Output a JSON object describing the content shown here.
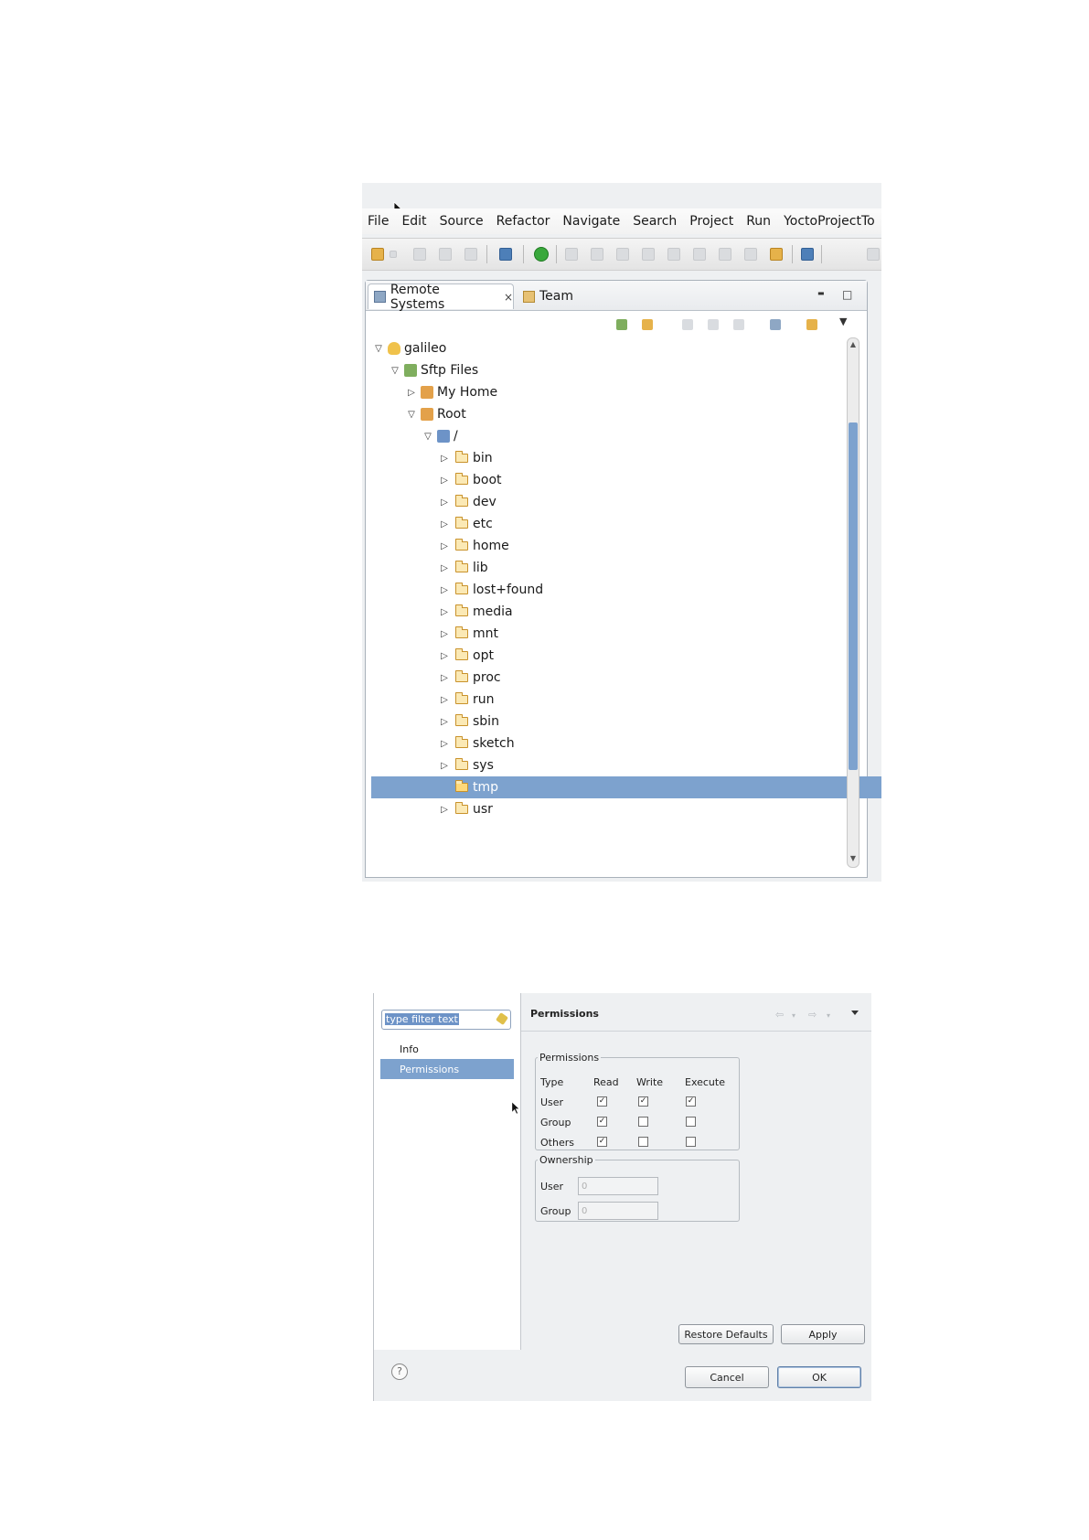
{
  "eclipse": {
    "menu": [
      "File",
      "Edit",
      "Source",
      "Refactor",
      "Navigate",
      "Search",
      "Project",
      "Run",
      "YoctoProjectTo"
    ],
    "tabs": {
      "remote_systems": "Remote Systems",
      "team": "Team"
    },
    "tree": {
      "host": "galileo",
      "subsystem": "Sftp Files",
      "my_home": "My Home",
      "root": "Root",
      "slash": "/",
      "folders": [
        "bin",
        "boot",
        "dev",
        "etc",
        "home",
        "lib",
        "lost+found",
        "media",
        "mnt",
        "opt",
        "proc",
        "run",
        "sbin",
        "sketch",
        "sys",
        "tmp",
        "usr"
      ],
      "selected": "tmp"
    },
    "icons": {
      "close": "×",
      "minimize": "▬",
      "maximize": "□",
      "expanded": "▽",
      "collapsed": "▷",
      "view_menu": "▼"
    }
  },
  "dialog": {
    "filter_placeholder": "type filter text",
    "nav": {
      "info": "Info",
      "permissions": "Permissions"
    },
    "page_title": "Permissions",
    "permissions": {
      "legend": "Permissions",
      "headers": {
        "type": "Type",
        "read": "Read",
        "write": "Write",
        "execute": "Execute"
      },
      "rows": {
        "user": {
          "label": "User",
          "read": true,
          "write": true,
          "execute": true
        },
        "group": {
          "label": "Group",
          "read": true,
          "write": false,
          "execute": false
        },
        "others": {
          "label": "Others",
          "read": true,
          "write": false,
          "execute": false
        }
      }
    },
    "ownership": {
      "legend": "Ownership",
      "user_label": "User",
      "user_value": "0",
      "group_label": "Group",
      "group_value": "0"
    },
    "buttons": {
      "restore": "Restore Defaults",
      "apply": "Apply",
      "cancel": "Cancel",
      "ok": "OK"
    },
    "help": "?",
    "check_mark": "✓"
  },
  "colors": {
    "selection": "#7da2ce",
    "accent_border": "#5f7fa8"
  }
}
